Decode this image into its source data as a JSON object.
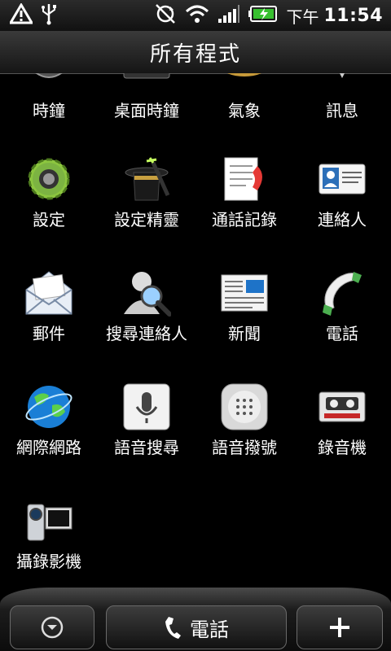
{
  "status": {
    "ampm": "下午",
    "time": "11:54"
  },
  "header": {
    "title": "所有程式"
  },
  "apps": [
    {
      "label": "時鐘",
      "icon": "clock-icon"
    },
    {
      "label": "桌面時鐘",
      "icon": "desk-clock-icon"
    },
    {
      "label": "氣象",
      "icon": "weather-icon"
    },
    {
      "label": "訊息",
      "icon": "messages-icon"
    },
    {
      "label": "設定",
      "icon": "settings-gear-icon"
    },
    {
      "label": "設定精靈",
      "icon": "setup-wizard-icon"
    },
    {
      "label": "通話記錄",
      "icon": "call-log-icon"
    },
    {
      "label": "連絡人",
      "icon": "contacts-icon"
    },
    {
      "label": "郵件",
      "icon": "mail-icon"
    },
    {
      "label": "搜尋連絡人",
      "icon": "search-contacts-icon"
    },
    {
      "label": "新聞",
      "icon": "news-icon"
    },
    {
      "label": "電話",
      "icon": "phone-icon"
    },
    {
      "label": "網際網路",
      "icon": "internet-globe-icon"
    },
    {
      "label": "語音搜尋",
      "icon": "voice-search-icon"
    },
    {
      "label": "語音撥號",
      "icon": "voice-dial-icon"
    },
    {
      "label": "錄音機",
      "icon": "recorder-icon"
    },
    {
      "label": "攝錄影機",
      "icon": "camcorder-icon"
    }
  ],
  "dock": {
    "phone_label": "電話"
  }
}
